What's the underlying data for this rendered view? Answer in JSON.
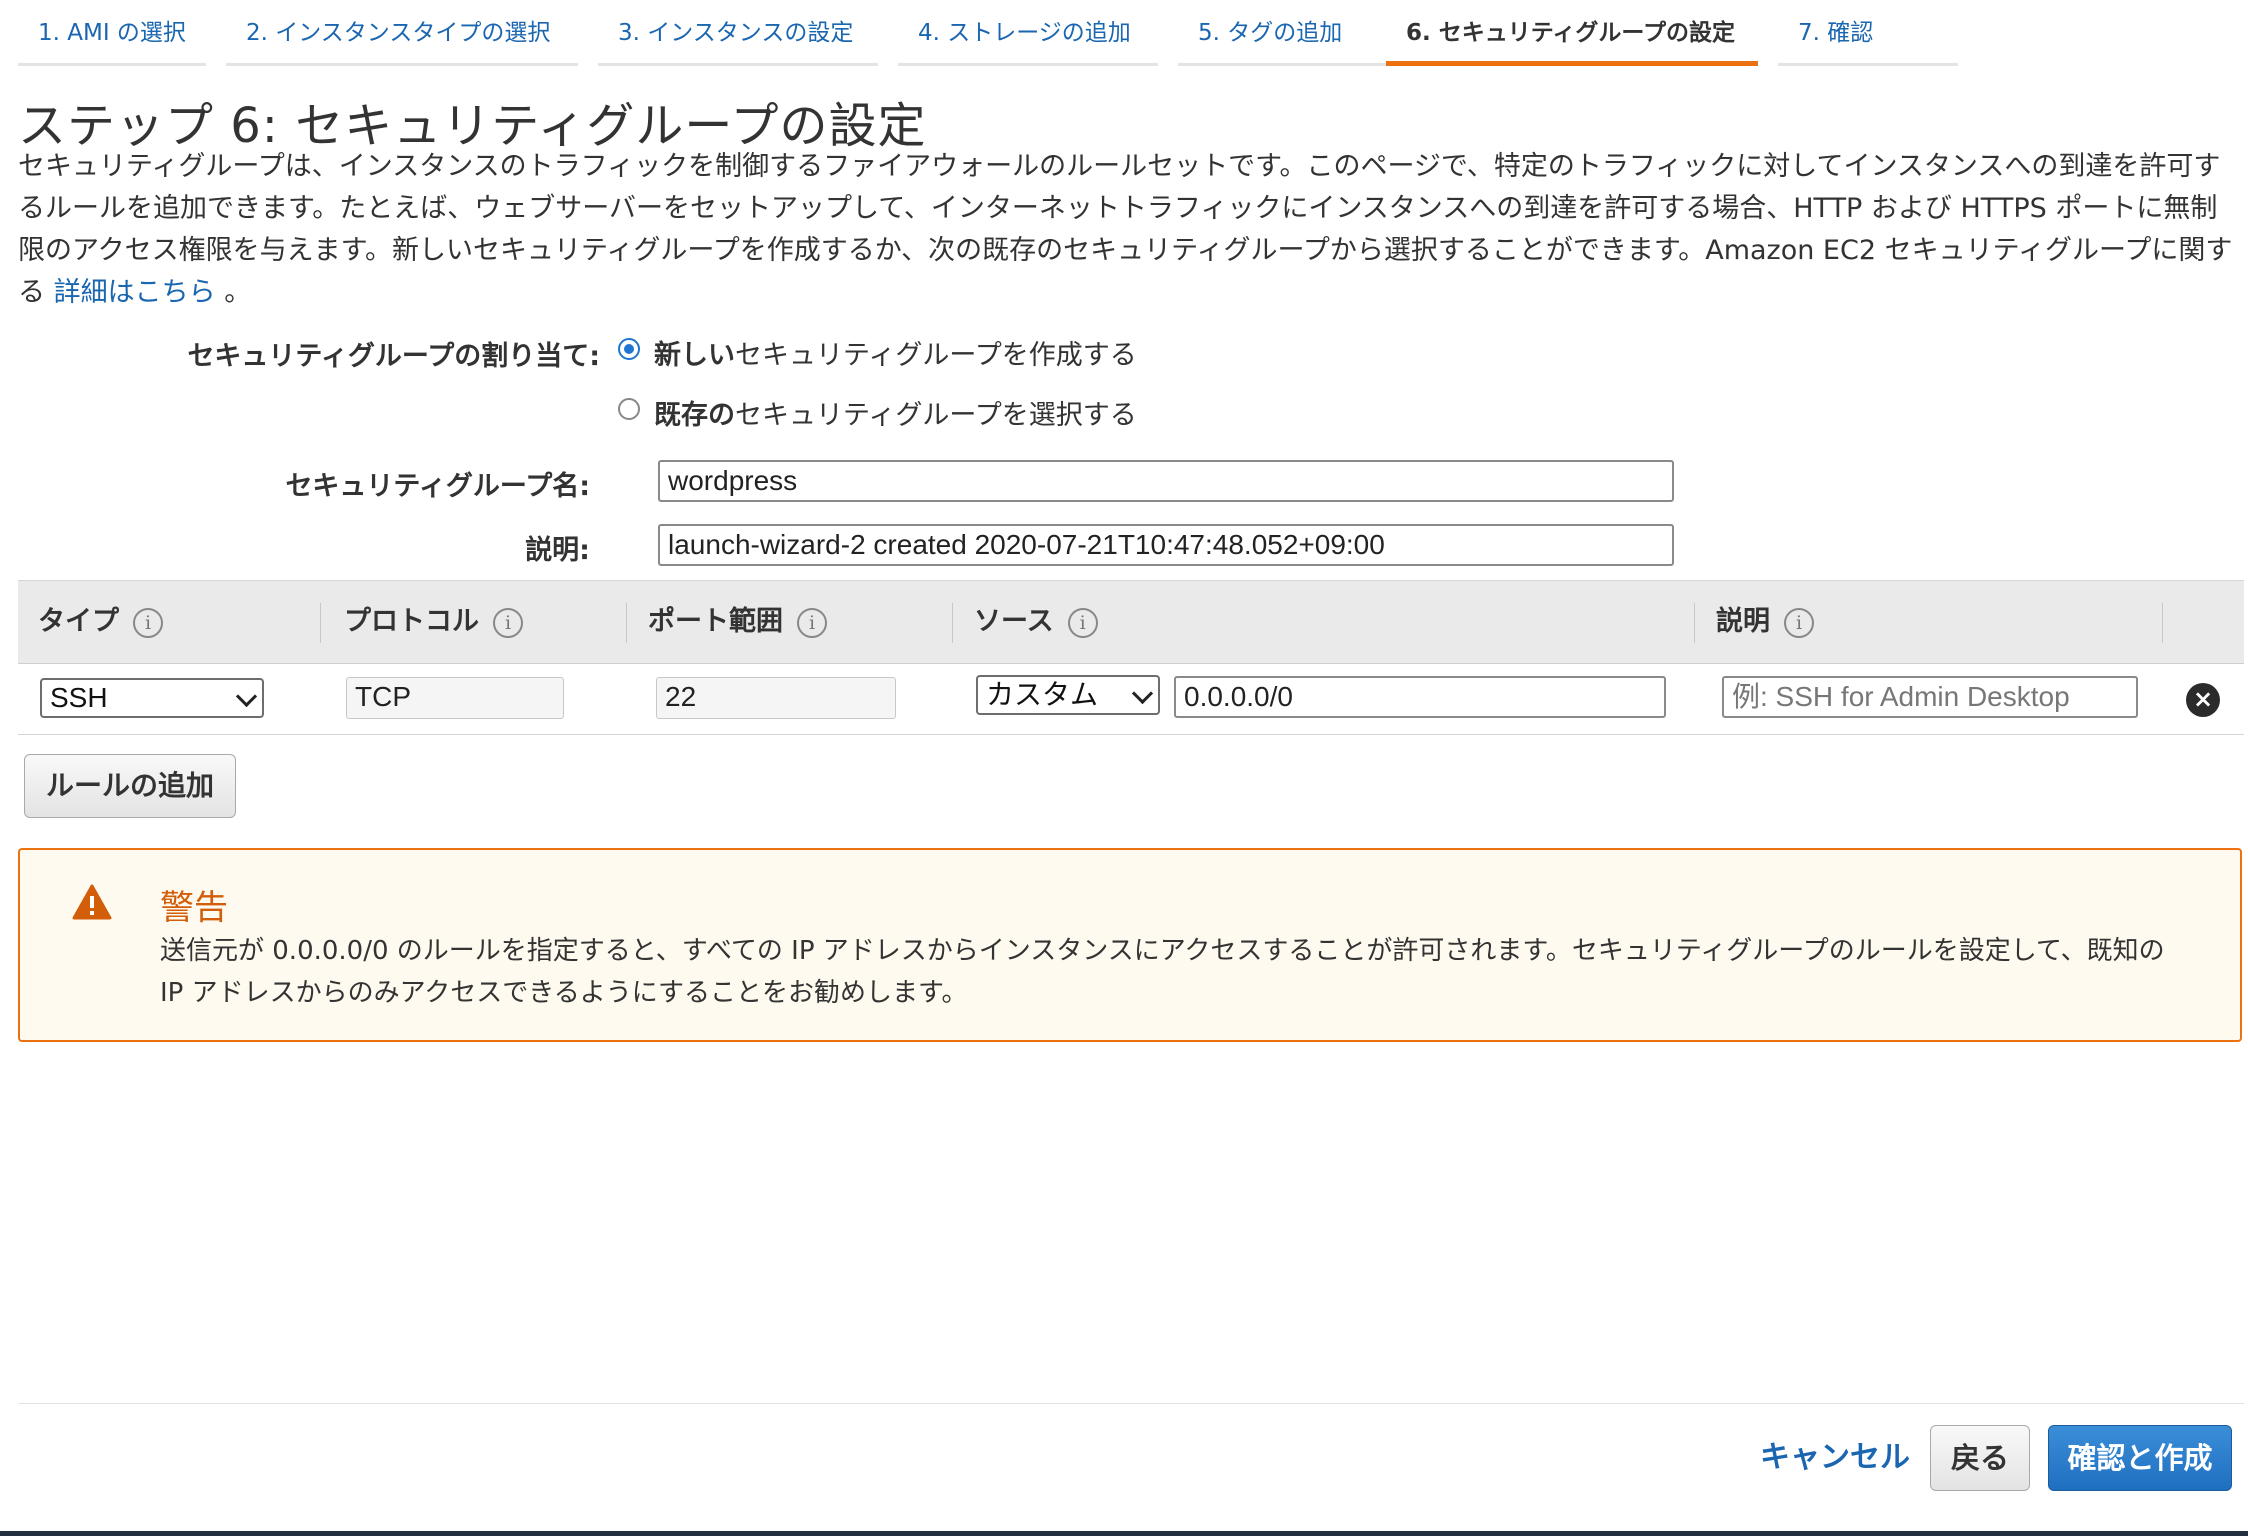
{
  "tabs": [
    {
      "label": "1. AMI の選択"
    },
    {
      "label": "2. インスタンスタイプの選択"
    },
    {
      "label": "3. インスタンスの設定"
    },
    {
      "label": "4. ストレージの追加"
    },
    {
      "label": "5. タグの追加"
    },
    {
      "label": "6. セキュリティグループの設定"
    },
    {
      "label": "7. 確認"
    }
  ],
  "page": {
    "title": "ステップ 6: セキュリティグループの設定",
    "description": "セキュリティグループは、インスタンスのトラフィックを制御するファイアウォールのルールセットです。このページで、特定のトラフィックに対してインスタンスへの到達を許可するルールを追加できます。たとえば、ウェブサーバーをセットアップして、インターネットトラフィックにインスタンスへの到達を許可する場合、HTTP および HTTPS ポートに無制限のアクセス権限を与えます。新しいセキュリティグループを作成するか、次の既存のセキュリティグループから選択することができます。Amazon EC2 セキュリティグループに関する",
    "learn_more": "詳細はこちら",
    "description_end": "。"
  },
  "assignment": {
    "label": "セキュリティグループの割り当て:",
    "option_new_bold": "新しい",
    "option_new_rest": "セキュリティグループを作成する",
    "option_existing_bold": "既存の",
    "option_existing_rest": "セキュリティグループを選択する",
    "selected": "new"
  },
  "form": {
    "name_label": "セキュリティグループ名:",
    "name_value": "wordpress",
    "desc_label": "説明:",
    "desc_value": "launch-wizard-2 created 2020-07-21T10:47:48.052+09:00"
  },
  "table": {
    "headers": [
      "タイプ",
      "プロトコル",
      "ポート範囲",
      "ソース",
      "説明"
    ],
    "info_glyph": "i",
    "rows": [
      {
        "type": "SSH",
        "protocol": "TCP",
        "port": "22",
        "source_mode": "カスタム",
        "source_cidr": "0.0.0.0/0",
        "description_placeholder": "例: SSH for Admin Desktop"
      }
    ],
    "remove_glyph": "×"
  },
  "add_rule_label": "ルールの追加",
  "warning": {
    "icon": "warning-triangle-icon",
    "title": "警告",
    "body": "送信元が 0.0.0.0/0 のルールを指定すると、すべての IP アドレスからインスタンスにアクセスすることが許可されます。セキュリティグループのルールを設定して、既知の IP アドレスからのみアクセスできるようにすることをお勧めします。",
    "color": "#ec7211"
  },
  "footer": {
    "cancel_label": "キャンセル",
    "back_label": "戻る",
    "review_label": "確認と作成"
  },
  "colors": {
    "accent": "#ec7211",
    "link": "#1a66b0",
    "primary": "#1f6fc0"
  }
}
